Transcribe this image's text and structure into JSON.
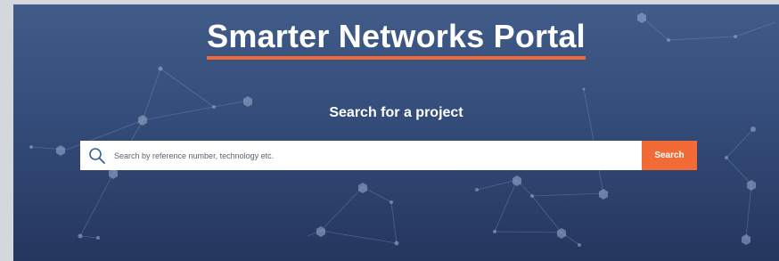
{
  "header": {
    "title": "Smarter Networks Portal",
    "title_underline_color": "#f26a35"
  },
  "search": {
    "heading": "Search for a project",
    "placeholder": "Search by reference number, technology etc.",
    "value": "",
    "button_label": "Search",
    "button_color": "#f26a35",
    "icon": "search-icon"
  },
  "background": {
    "style": "network-nodes-graphic",
    "gradient_top": "#415c8a",
    "gradient_bottom": "#25365e"
  }
}
